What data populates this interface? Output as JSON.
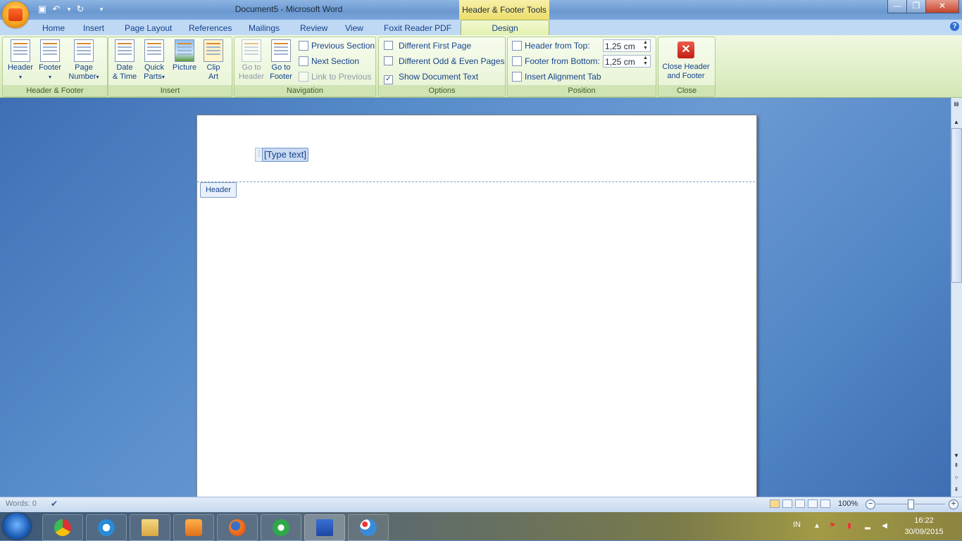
{
  "window": {
    "title": "Document5 - Microsoft Word",
    "contextual_title": "Header & Footer Tools",
    "minimize": "—",
    "restore": "❐",
    "close": "✕"
  },
  "qat": {
    "save_icon": "save-icon",
    "undo_icon": "undo-icon",
    "redo_icon": "redo-icon",
    "customize_icon": "customize-qat-icon"
  },
  "tabs": [
    "Home",
    "Insert",
    "Page Layout",
    "References",
    "Mailings",
    "Review",
    "View",
    "Foxit Reader PDF",
    "Design"
  ],
  "ribbon": {
    "groups": {
      "header_footer": {
        "label": "Header & Footer",
        "header": "Header",
        "footer": "Footer",
        "page_number_1": "Page",
        "page_number_2": "Number"
      },
      "insert": {
        "label": "Insert",
        "date_1": "Date",
        "date_2": "& Time",
        "quick_1": "Quick",
        "quick_2": "Parts",
        "picture": "Picture",
        "clip_1": "Clip",
        "clip_2": "Art"
      },
      "navigation": {
        "label": "Navigation",
        "goto_header_1": "Go to",
        "goto_header_2": "Header",
        "goto_footer_1": "Go to",
        "goto_footer_2": "Footer",
        "previous_section": "Previous Section",
        "next_section": "Next Section",
        "link_previous": "Link to Previous"
      },
      "options": {
        "label": "Options",
        "different_first": "Different First Page",
        "different_odd_even": "Different Odd & Even Pages",
        "show_document_text": "Show Document Text",
        "different_first_checked": false,
        "different_odd_even_checked": false,
        "show_document_text_checked": true,
        "check_glyph": "✓"
      },
      "position": {
        "label": "Position",
        "header_from_top": "Header from Top:",
        "footer_from_bottom": "Footer from Bottom:",
        "header_value": "1,25 cm",
        "footer_value": "1,25 cm",
        "insert_alignment_tab": "Insert Alignment Tab"
      },
      "close": {
        "label": "Close",
        "close_1": "Close Header",
        "close_2": "and Footer"
      }
    }
  },
  "document": {
    "placeholder": "[Type text]",
    "header_tag": "Header"
  },
  "statusbar": {
    "words": "Words: 0",
    "zoom": "100%",
    "zoom_out": "−",
    "zoom_in": "+",
    "zoom_level": 100
  },
  "taskbar": {
    "apps": [
      "chrome-icon",
      "internet-explorer-icon",
      "file-explorer-icon",
      "media-player-icon",
      "firefox-icon",
      "camtasia-icon",
      "word-icon",
      "paint-icon"
    ],
    "language": "IN",
    "time": "16:22",
    "date": "30/09/2015"
  },
  "colors": {
    "ribbon_bg": "#dcedc3",
    "tab_bar": "#bfd8f3",
    "design_tab": "#e1f0a8",
    "close_red": "#d7281c"
  }
}
